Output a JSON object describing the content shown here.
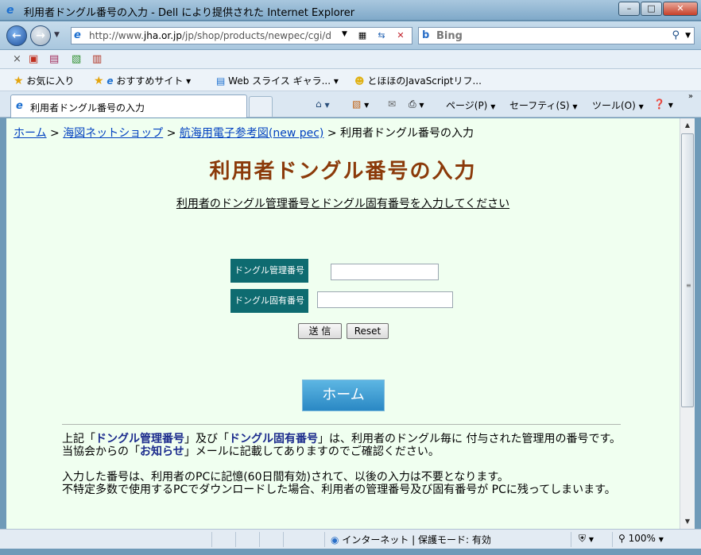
{
  "window": {
    "title": "利用者ドングル番号の入力 - Dell により提供された Internet Explorer",
    "minimize": "–",
    "maximize": "□",
    "close": "✕"
  },
  "address": {
    "url_prefix": "http://www.",
    "url_domain": "jha.or.jp",
    "url_rest": "/jp/shop/products/newpec/cgi/d",
    "search_placeholder": "Bing"
  },
  "favorites": {
    "favorites_label": "お気に入り",
    "items": [
      {
        "label": "おすすめサイト ▾"
      },
      {
        "label": "Web スライス ギャラ... ▾"
      },
      {
        "label": "とほほのJavaScriptリフ..."
      }
    ]
  },
  "tabs": [
    {
      "title": "利用者ドングル番号の入力"
    }
  ],
  "commands": {
    "page": "ページ(P)",
    "safety": "セーフティ(S)",
    "tools": "ツール(O)"
  },
  "breadcrumb": {
    "items": [
      "ホーム",
      "海図ネットショップ",
      "航海用電子参考図(new pec)"
    ],
    "current": "利用者ドングル番号の入力",
    "separator": ">"
  },
  "page": {
    "title": "利用者ドングル番号の入力",
    "instruction": "利用者のドングル管理番号とドングル固有番号を入力してください"
  },
  "form": {
    "field1_label": "ドングル管理番号",
    "field2_label": "ドングル固有番号",
    "field1_value": "",
    "field2_value": "",
    "submit_label": "送 信",
    "reset_label": "Reset",
    "home_label": "ホーム"
  },
  "notes": {
    "line1_a": "上記「",
    "line1_hl1": "ドングル管理番号",
    "line1_b": "」及び「",
    "line1_hl2": "ドングル固有番号",
    "line1_c": "」は、利用者のドングル毎に 付与された管理用の番号です。",
    "line2_a": "当協会からの「",
    "line2_hl": "お知らせ",
    "line2_b": "」メールに記載してありますのでご確認ください。",
    "line3": "入力した番号は、利用者のPCに記憶(60日間有効)されて、以後の入力は不要となります。",
    "line4": "不特定多数で使用するPCでダウンロードした場合、利用者の管理番号及び固有番号が PCに残ってしまいます。"
  },
  "status": {
    "zone": "インターネット | 保護モード: 有効",
    "zoom": "100%"
  }
}
